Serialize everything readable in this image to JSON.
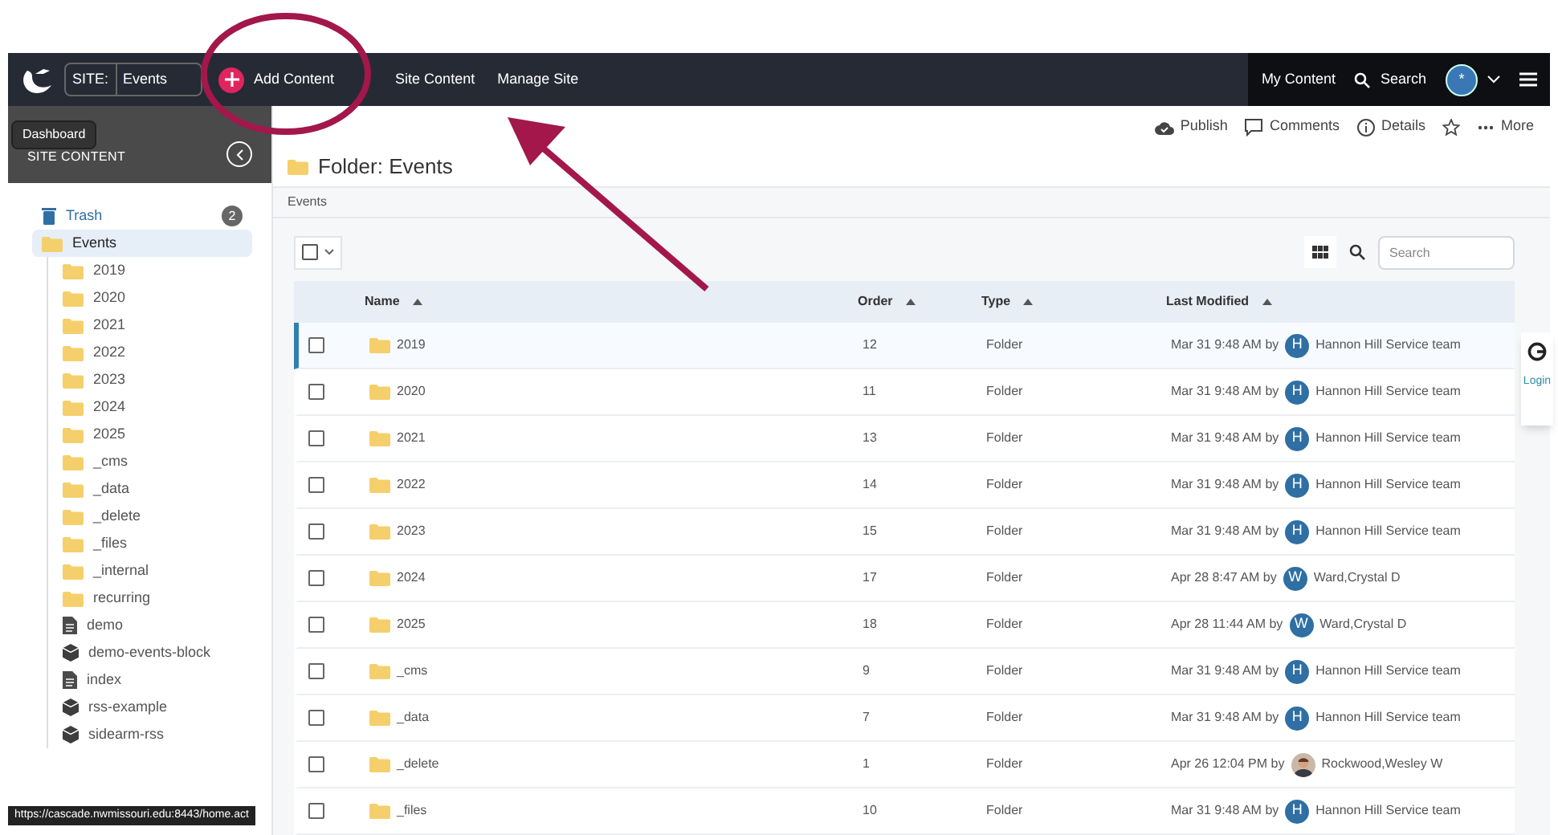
{
  "navbar": {
    "site_label": "SITE:",
    "site_value": "Events",
    "add_content": "Add Content",
    "links": [
      "Site Content",
      "Manage Site"
    ],
    "my_content": "My Content",
    "search": "Search",
    "avatar": "*"
  },
  "tooltip": "Dashboard",
  "sidebar": {
    "title": "SITE CONTENT",
    "tree": [
      {
        "label": "Trash",
        "kind": "trash",
        "count": "2",
        "selected": false
      },
      {
        "label": "Events",
        "kind": "folder",
        "selected": true,
        "children": [
          {
            "label": "2019",
            "kind": "folder",
            "selected": false
          },
          {
            "label": "2020",
            "kind": "folder",
            "selected": false
          },
          {
            "label": "2021",
            "kind": "folder",
            "selected": false
          },
          {
            "label": "2022",
            "kind": "folder",
            "selected": false
          },
          {
            "label": "2023",
            "kind": "folder",
            "selected": false
          },
          {
            "label": "2024",
            "kind": "folder",
            "selected": false
          },
          {
            "label": "2025",
            "kind": "folder",
            "selected": false
          },
          {
            "label": "_cms",
            "kind": "folder",
            "selected": false
          },
          {
            "label": "_data",
            "kind": "folder",
            "selected": false
          },
          {
            "label": "_delete",
            "kind": "folder",
            "selected": false
          },
          {
            "label": "_files",
            "kind": "folder",
            "selected": false
          },
          {
            "label": "_internal",
            "kind": "folder",
            "selected": false
          },
          {
            "label": "recurring",
            "kind": "folder",
            "selected": false
          },
          {
            "label": "demo",
            "kind": "page",
            "selected": false
          },
          {
            "label": "demo-events-block",
            "kind": "block",
            "selected": false
          },
          {
            "label": "index",
            "kind": "page",
            "selected": false
          },
          {
            "label": "rss-example",
            "kind": "block",
            "selected": false
          },
          {
            "label": "sidearm-rss",
            "kind": "block",
            "selected": false
          }
        ]
      }
    ]
  },
  "toolbar": [
    "Publish",
    "Comments",
    "Details",
    "More"
  ],
  "folder_title": "Folder: Events",
  "breadcrumb": "Events",
  "table_search": {
    "placeholder": "Search"
  },
  "select_all": {
    "checked": false
  },
  "table": {
    "columns": [
      "Name",
      "Order",
      "Type",
      "Last Modified"
    ],
    "rows": [
      {
        "name": "2019",
        "order": "12",
        "type": "Folder",
        "modified": "Mar 31 9:48 AM by",
        "avatar": {
          "kind": "letter",
          "letter": "H"
        },
        "user": "Hannon Hill Service team",
        "checked": false,
        "selected": true
      },
      {
        "name": "2020",
        "order": "11",
        "type": "Folder",
        "modified": "Mar 31 9:48 AM by",
        "avatar": {
          "kind": "letter",
          "letter": "H"
        },
        "user": "Hannon Hill Service team",
        "checked": false,
        "selected": false
      },
      {
        "name": "2021",
        "order": "13",
        "type": "Folder",
        "modified": "Mar 31 9:48 AM by",
        "avatar": {
          "kind": "letter",
          "letter": "H"
        },
        "user": "Hannon Hill Service team",
        "checked": false,
        "selected": false
      },
      {
        "name": "2022",
        "order": "14",
        "type": "Folder",
        "modified": "Mar 31 9:48 AM by",
        "avatar": {
          "kind": "letter",
          "letter": "H"
        },
        "user": "Hannon Hill Service team",
        "checked": false,
        "selected": false
      },
      {
        "name": "2023",
        "order": "15",
        "type": "Folder",
        "modified": "Mar 31 9:48 AM by",
        "avatar": {
          "kind": "letter",
          "letter": "H"
        },
        "user": "Hannon Hill Service team",
        "checked": false,
        "selected": false
      },
      {
        "name": "2024",
        "order": "17",
        "type": "Folder",
        "modified": "Apr 28 8:47 AM by",
        "avatar": {
          "kind": "letter",
          "letter": "W"
        },
        "user": "Ward,Crystal D",
        "checked": false,
        "selected": false
      },
      {
        "name": "2025",
        "order": "18",
        "type": "Folder",
        "modified": "Apr 28 11:44 AM by",
        "avatar": {
          "kind": "letter",
          "letter": "W"
        },
        "user": "Ward,Crystal D",
        "checked": false,
        "selected": false
      },
      {
        "name": "_cms",
        "order": "9",
        "type": "Folder",
        "modified": "Mar 31 9:48 AM by",
        "avatar": {
          "kind": "letter",
          "letter": "H"
        },
        "user": "Hannon Hill Service team",
        "checked": false,
        "selected": false
      },
      {
        "name": "_data",
        "order": "7",
        "type": "Folder",
        "modified": "Mar 31 9:48 AM by",
        "avatar": {
          "kind": "letter",
          "letter": "H"
        },
        "user": "Hannon Hill Service team",
        "checked": false,
        "selected": false
      },
      {
        "name": "_delete",
        "order": "1",
        "type": "Folder",
        "modified": "Apr 26 12:04 PM by",
        "user": "Rockwood,Wesley W",
        "checked": false,
        "selected": false
      },
      {
        "name": "_files",
        "order": "10",
        "type": "Folder",
        "modified": "Mar 31 9:48 AM by",
        "avatar": {
          "kind": "letter",
          "letter": "H"
        },
        "user": "Hannon Hill Service team",
        "checked": false,
        "selected": false
      }
    ]
  },
  "side_widget": "Login",
  "status_url": "https://cascade.nwmissouri.edu:8443/home.act"
}
